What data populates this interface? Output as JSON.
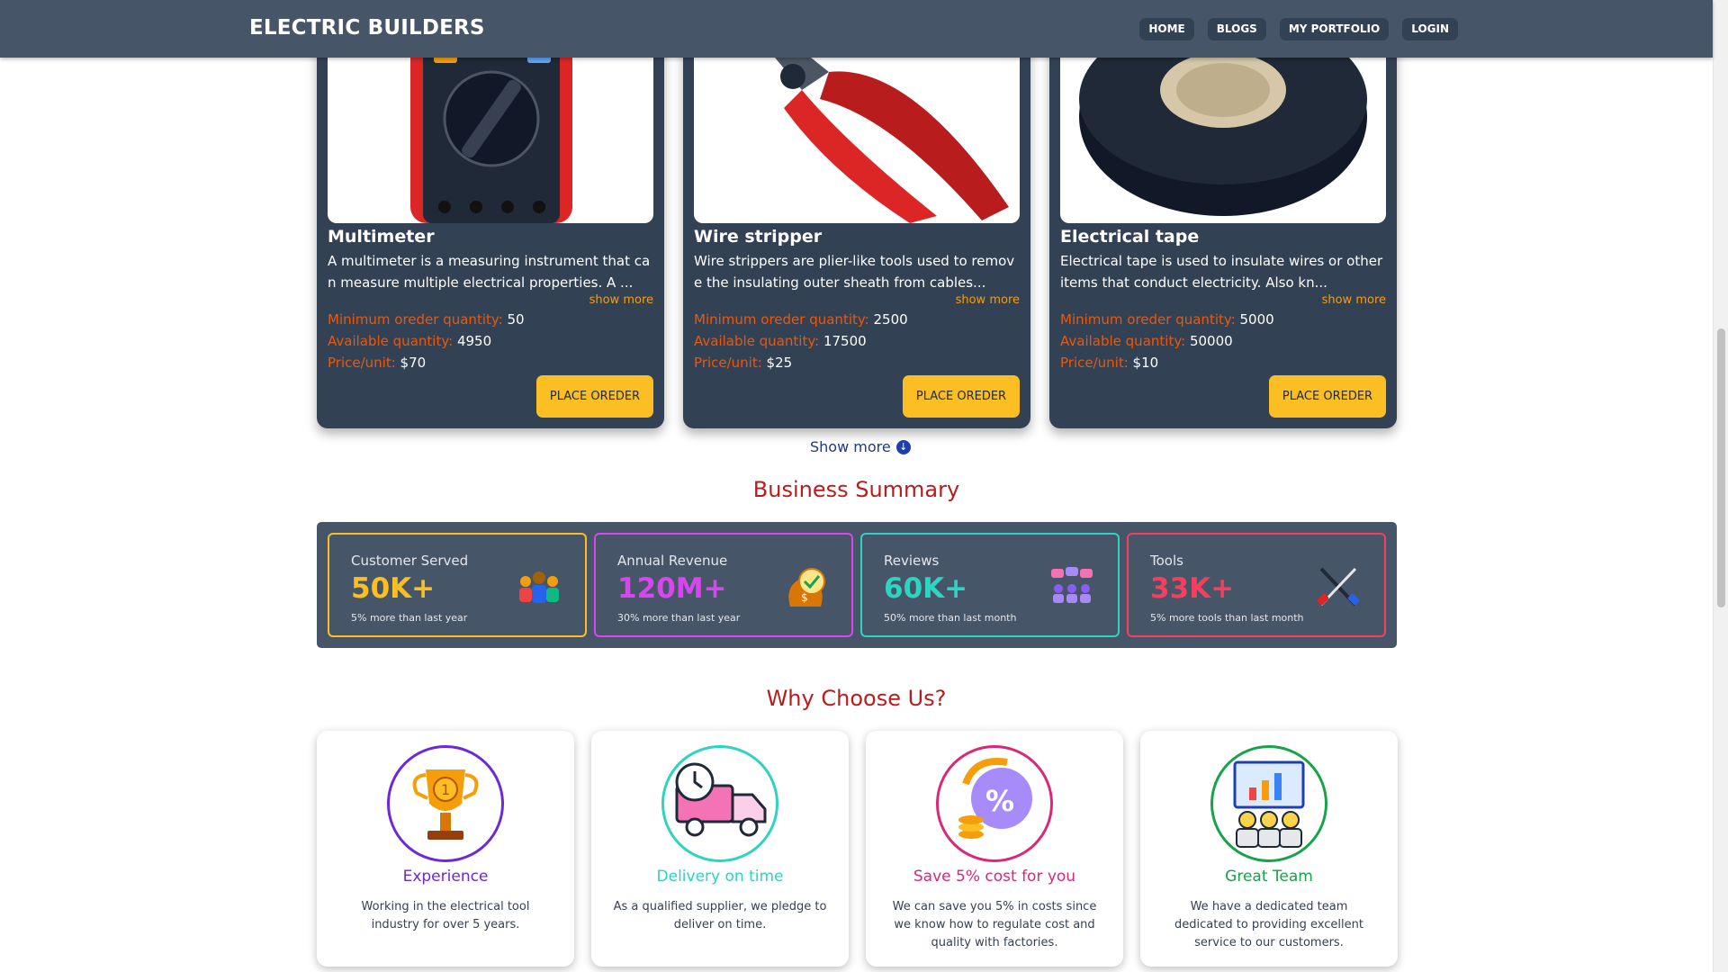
{
  "nav": {
    "brand": "ELECTRIC BUILDERS",
    "links": [
      "HOME",
      "BLOGS",
      "MY PORTFOLIO",
      "LOGIN"
    ]
  },
  "products": [
    {
      "name": "Multimeter",
      "description": "A multimeter is a measuring instrument that can measure multiple electrical properties. A ...",
      "show_more": "show more",
      "min_order_label": "Minimum oreder quantity:",
      "min_order": "50",
      "available_label": "Available quantity:",
      "available": "4950",
      "price_label": "Price/unit:",
      "price": "$70",
      "button": "PLACE OREDER"
    },
    {
      "name": "Wire stripper",
      "description": "Wire strippers are plier-like tools used to remove the insulating outer sheath from cables...",
      "show_more": "show more",
      "min_order_label": "Minimum oreder quantity:",
      "min_order": "2500",
      "available_label": "Available quantity:",
      "available": "17500",
      "price_label": "Price/unit:",
      "price": "$25",
      "button": "PLACE OREDER"
    },
    {
      "name": "Electrical tape",
      "description": "Electrical tape is used to insulate wires or other items that conduct electricity. Also kn...",
      "show_more": "show more",
      "min_order_label": "Minimum oreder quantity:",
      "min_order": "5000",
      "available_label": "Available quantity:",
      "available": "50000",
      "price_label": "Price/unit:",
      "price": "$10",
      "button": "PLACE OREDER"
    }
  ],
  "show_more_link": "Show more",
  "summary": {
    "title": "Business Summary",
    "items": [
      {
        "label": "Customer Served",
        "value": "50K+",
        "sub": "5% more than last year",
        "color": "#fbbf24"
      },
      {
        "label": "Annual Revenue",
        "value": "120M+",
        "sub": "30% more than last year",
        "color": "#d946ef"
      },
      {
        "label": "Reviews",
        "value": "60K+",
        "sub": "50% more than last month",
        "color": "#2dd4bf"
      },
      {
        "label": "Tools",
        "value": "33K+",
        "sub": "5% more tools than last month",
        "color": "#f43f5e"
      }
    ]
  },
  "why": {
    "title": "Why Choose Us?",
    "items": [
      {
        "title": "Experience",
        "text": "Working in the electrical tool industry for over 5 years.",
        "color": "#6d28d9"
      },
      {
        "title": "Delivery on time",
        "text": "As a qualified supplier, we pledge to deliver on time.",
        "color": "#2dd4bf"
      },
      {
        "title": "Save 5% cost for you",
        "text": "We can save you 5% in costs since we know how to regulate cost and quality with factories.",
        "color": "#db2777"
      },
      {
        "title": "Great Team",
        "text": "We have a dedicated team dedicated to providing excellent service to our customers.",
        "color": "#16a34a"
      }
    ]
  }
}
